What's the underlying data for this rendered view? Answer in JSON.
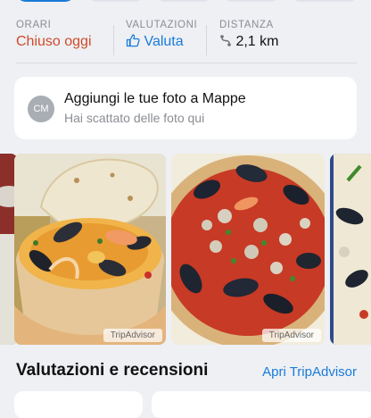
{
  "info": {
    "hours_label": "ORARI",
    "hours_value": "Chiuso oggi",
    "rating_label": "VALUTAZIONI",
    "rating_value": "Valuta",
    "distance_label": "DISTANZA",
    "distance_value": "2,1 km"
  },
  "photo_prompt": {
    "avatar_initials": "CM",
    "title": "Aggiungi le tue foto a Mappe",
    "subtitle": "Hai scattato delle foto qui"
  },
  "gallery": {
    "credit_1": "TripAdvisor",
    "credit_2": "TripAdvisor"
  },
  "reviews": {
    "title": "Valutazioni e recensioni",
    "link": "Apri TripAdvisor"
  },
  "colors": {
    "accent": "#1a7bd9",
    "closed": "#d04a2a",
    "background": "#eef0f4"
  },
  "icons": {
    "rating": "thumbs-up-icon",
    "distance": "route-icon"
  }
}
